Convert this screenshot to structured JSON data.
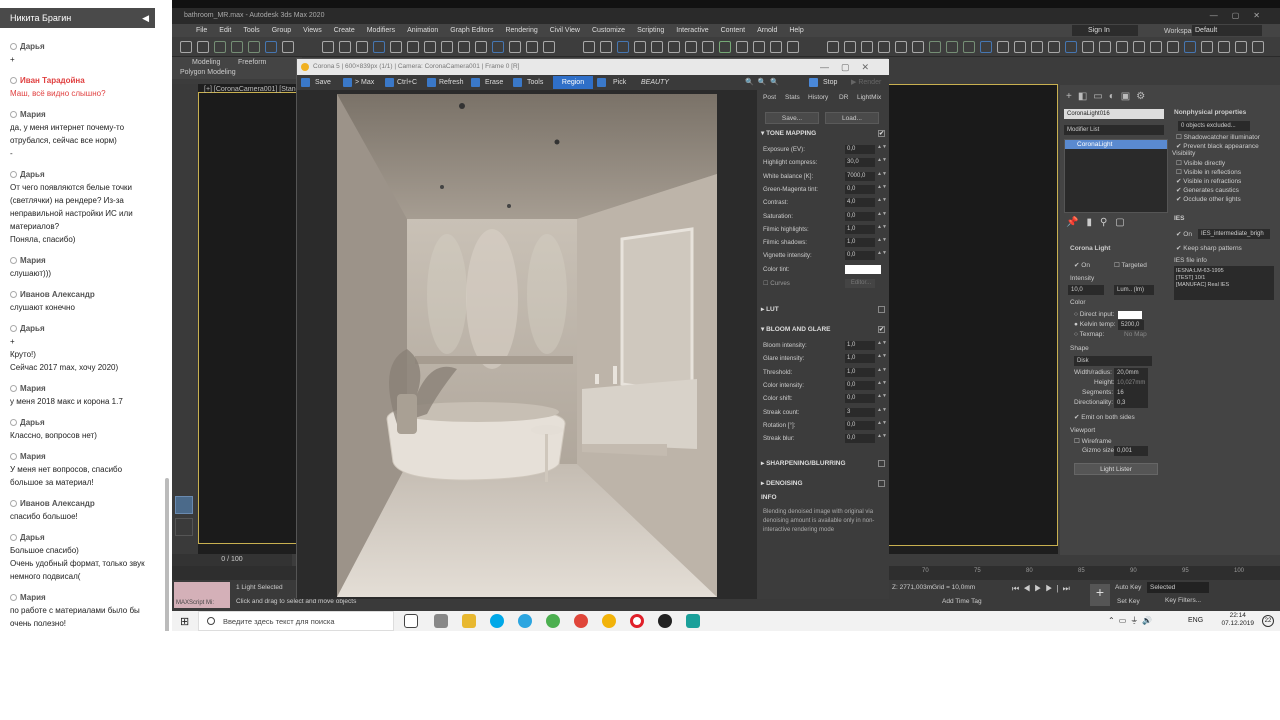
{
  "chat": {
    "owner": "Никита Брагин",
    "messages": [
      {
        "name": "Дарья",
        "text": "+",
        "red": false
      },
      {
        "name": "Иван Тарадойна",
        "text": "Маш, всё видно слышно?",
        "red": true
      },
      {
        "name": "Мария",
        "text": "да, у меня интернет почему-то отрубался, сейчас все норм)\n-",
        "red": false
      },
      {
        "name": "Дарья",
        "text": "От чего появляются белые точки (светлячки) на рендере? Из-за неправильной настройки ИС или материалов?\nПоняла, спасибо)",
        "red": false
      },
      {
        "name": "Мария",
        "text": "слушают)))",
        "red": false
      },
      {
        "name": "Иванов Александр",
        "text": "слушают конечно",
        "red": false
      },
      {
        "name": "Дарья",
        "text": "+\nКруто!)\nСейчас 2017 max, хочу 2020)",
        "red": false
      },
      {
        "name": "Мария",
        "text": "у меня 2018 макс и корона 1.7",
        "red": false
      },
      {
        "name": "Дарья",
        "text": "Классно, вопросов нет)",
        "red": false
      },
      {
        "name": "Мария",
        "text": "У меня нет вопросов, спасибо большое за материал!",
        "red": false
      },
      {
        "name": "Иванов Александр",
        "text": "спасибо большое!",
        "red": false
      },
      {
        "name": "Дарья",
        "text": "Большое спасибо)\nОчень удобный формат, только звук немного подвисал(",
        "red": false
      },
      {
        "name": "Мария",
        "text": "по работе с материалами было бы очень полезно!\nФормат очень удобный)",
        "red": false
      }
    ]
  },
  "max": {
    "title": "bathroom_MR.max - Autodesk 3ds Max 2020",
    "menu": [
      "File",
      "Edit",
      "Tools",
      "Group",
      "Views",
      "Create",
      "Modifiers",
      "Animation",
      "Graph Editors",
      "Rendering",
      "Civil View",
      "Customize",
      "Scripting",
      "Interactive",
      "Content",
      "Arnold",
      "Help"
    ],
    "signin": "Sign In",
    "workspaces_label": "Workspaces:",
    "workspace": "Default",
    "ribbon_tabs": [
      "Modeling",
      "Freeform"
    ],
    "ribbon_sub": "Polygon Modeling",
    "viewport_label": "[+] [CoronaCamera001] [Standa",
    "timeslider": "0 / 100",
    "maxscript": "MAXScript Mi:",
    "status1": "1 Light Selected",
    "status2": "Click and drag to select and move objects",
    "zcoord": "Z: 2771,003m",
    "grid": "Grid = 10,0mm",
    "add_time_tag": "Add Time Tag",
    "auto_key": "Auto Key",
    "set_key": "Set Key",
    "selected": "Selected",
    "key_filters": "Key Filters...",
    "ticks": [
      "70",
      "75",
      "80",
      "85",
      "90",
      "95",
      "100"
    ]
  },
  "corona": {
    "title": "Corona 5 | 600×839px (1/1) | Camera: CoronaCamera001 | Frame 0 [R]",
    "tools": [
      "Save",
      "> Max",
      "Ctrl+C",
      "Refresh",
      "Erase",
      "Tools",
      "Region",
      "Pick",
      "BEAUTY"
    ],
    "stop": "Stop",
    "render_label": "Render",
    "tabs": [
      "Post",
      "Stats",
      "History",
      "DR",
      "LightMix"
    ],
    "save_btn": "Save...",
    "load_btn": "Load...",
    "tone_mapping": "TONE MAPPING",
    "params": [
      {
        "label": "Exposure (EV):",
        "value": "0,0"
      },
      {
        "label": "Highlight compress:",
        "value": "30,0"
      },
      {
        "label": "White balance [K]:",
        "value": "7000,0"
      },
      {
        "label": "Green-Magenta tint:",
        "value": "0,0"
      },
      {
        "label": "Contrast:",
        "value": "4,0"
      },
      {
        "label": "Saturation:",
        "value": "0,0"
      },
      {
        "label": "Filmic highlights:",
        "value": "1,0"
      },
      {
        "label": "Filmic shadows:",
        "value": "1,0"
      },
      {
        "label": "Vignette intensity:",
        "value": "0,0"
      }
    ],
    "color_tint": "Color tint:",
    "curves": "Curves",
    "curves_btn": "Editor...",
    "lut": "LUT",
    "bloom": "BLOOM AND GLARE",
    "bloom_params": [
      {
        "label": "Bloom intensity:",
        "value": "1,0"
      },
      {
        "label": "Glare intensity:",
        "value": "1,0"
      },
      {
        "label": "Threshold:",
        "value": "1,0"
      },
      {
        "label": "Color intensity:",
        "value": "0,0"
      },
      {
        "label": "Color shift:",
        "value": "0,0"
      },
      {
        "label": "Streak count:",
        "value": "3"
      },
      {
        "label": "Rotation [°]:",
        "value": "0,0"
      },
      {
        "label": "Streak blur:",
        "value": "0,0"
      }
    ],
    "sharpening": "SHARPENING/BLURRING",
    "denoising": "DENOISING",
    "info_title": "INFO",
    "info_text": "Blending denoised image with original via denoising amount is available only in non-interactive rendering mode"
  },
  "panel": {
    "object": "CoronaLight016",
    "modifier_list": "Modifier List",
    "stack_item": "CoronaLight",
    "nonphys": "Nonphysical properties",
    "excluded": "0 objects excluded...",
    "shadowcatcher": "Shadowcatcher illuminator",
    "prevent_black": "Prevent black appearance",
    "visibility": "Visibility",
    "vis_items": [
      "Visible directly",
      "Visible in reflections",
      "Visible in refractions",
      "Generates caustics",
      "Occlude other lights"
    ],
    "ies": "IES",
    "ies_on": "On",
    "ies_file": "IES_intermediate_brigh",
    "keep_sharp": "Keep sharp patterns",
    "ies_info": "IES file info",
    "ies_info_text": "IESNA:LM-63-1995\n[TEST] 10/1\n[MANUFAC] Real IES",
    "corona_light": "Corona Light",
    "on": "On",
    "targeted": "Targeted",
    "intensity": "Intensity",
    "intensity_val": "10,0",
    "intensity_unit": "Lum.. (lm)",
    "color": "Color",
    "direct_input": "Direct input:",
    "kelvin": "Kelvin temp:",
    "kelvin_val": "5200,0",
    "texmap": "Texmap:",
    "texmap_val": "No Map",
    "shape": "Shape",
    "shape_val": "Disk",
    "width": "Width/radius:",
    "width_val": "20,0mm",
    "height": "Height:",
    "height_val": "10,027mm",
    "segments": "Segments:",
    "segments_val": "16",
    "directionality": "Directionality:",
    "directionality_val": "0,3",
    "emit": "Emit on both sides",
    "viewport": "Viewport",
    "wireframe": "Wireframe",
    "gizmo": "Gizmo size:",
    "gizmo_val": "0,001",
    "light_lister": "Light Lister"
  },
  "taskbar": {
    "search_placeholder": "Введите здесь текст для поиска",
    "lang": "ENG",
    "time": "22:14",
    "date": "07.12.2019",
    "notif": "22"
  }
}
